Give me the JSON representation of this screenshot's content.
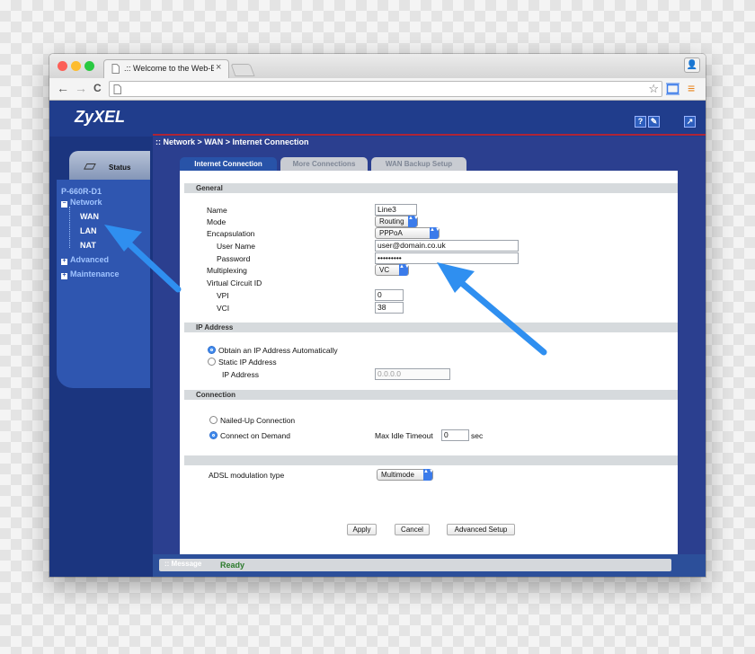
{
  "browser": {
    "tab_title": ".:: Welcome to the Web-Ba",
    "tab_close": "×",
    "url": "",
    "back_glyph": "←",
    "forward_glyph": "→",
    "reload_glyph": "C",
    "star_glyph": "☆",
    "menu_glyph": "≡",
    "profile_glyph": "👤",
    "icons": [
      "back-icon",
      "forward-icon",
      "reload-icon",
      "page-icon",
      "star-icon",
      "cast-icon",
      "menu-icon",
      "profile-icon"
    ]
  },
  "header": {
    "logo": "ZyXEL",
    "help_glyph": "?",
    "wizard_glyph": "✎",
    "logout_glyph": "↗"
  },
  "breadcrumb": "Network > WAN > Internet Connection",
  "sidebar": {
    "status_label": "Status",
    "model": "P-660R-D1",
    "items": [
      {
        "label": "Network",
        "expand": "−"
      },
      {
        "label": "WAN"
      },
      {
        "label": "LAN"
      },
      {
        "label": "NAT"
      },
      {
        "label": "Advanced",
        "expand": "+"
      },
      {
        "label": "Maintenance",
        "expand": "+"
      }
    ]
  },
  "tabs": [
    "Internet Connection",
    "More Connections",
    "WAN Backup Setup"
  ],
  "general": {
    "section": "General",
    "name_label": "Name",
    "name_value": "Line3",
    "mode_label": "Mode",
    "mode_value": "Routing",
    "encap_label": "Encapsulation",
    "encap_value": "PPPoA",
    "user_label": "User Name",
    "user_value": "user@domain.co.uk",
    "pass_label": "Password",
    "pass_value": "•••••••••",
    "mux_label": "Multiplexing",
    "mux_value": "VC",
    "vc_label": "Virtual Circuit ID",
    "vpi_label": "VPI",
    "vpi_value": "0",
    "vci_label": "VCI",
    "vci_value": "38"
  },
  "ip": {
    "section": "IP Address",
    "auto_label": "Obtain an IP Address Automatically",
    "static_label": "Static IP Address",
    "ip_label": "IP Address",
    "ip_value": "0.0.0.0"
  },
  "connection": {
    "section": "Connection",
    "nailed_label": "Nailed-Up Connection",
    "demand_label": "Connect on Demand",
    "idle_label": "Max Idle Timeout",
    "idle_value": "0",
    "idle_unit": "sec"
  },
  "adsl": {
    "label": "ADSL modulation type",
    "value": "Multimode"
  },
  "buttons": {
    "apply": "Apply",
    "cancel": "Cancel",
    "advanced": "Advanced Setup"
  },
  "message": {
    "label": ":: Message",
    "value": "Ready"
  },
  "select_arrow": "▲▼",
  "colors": {
    "accent": "#203d8c",
    "annotation_arrow": "#2f8ff0",
    "status_ok": "#2b7a2b"
  }
}
